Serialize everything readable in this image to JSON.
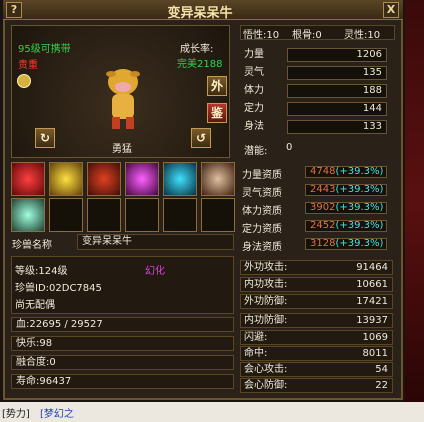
{
  "window": {
    "title": "变异呆呆牛",
    "help_label": "?",
    "close_label": "X"
  },
  "pet": {
    "level_carry": "95级可携带",
    "rarity": "贵重",
    "growth_label": "成长率:",
    "growth_value": "完美2188",
    "external_btn": "外",
    "inspect_btn": "鉴",
    "temperament": "勇猛",
    "name_label": "珍兽名称",
    "name_value": "变异呆呆牛",
    "level": "等级:124级",
    "transform": "幻化",
    "pet_id": "珍兽ID:02DC7845",
    "spouse": "尚无配偶",
    "hp": "血:22695 / 29527",
    "happiness": "快乐:98",
    "fusion": "融合度:0",
    "lifespan": "寿命:96437"
  },
  "header_stats": {
    "wuxing": "悟性:10",
    "genbone": "根骨:0",
    "lingxing": "灵性:10"
  },
  "stats": [
    {
      "name": "力量",
      "value": "1206"
    },
    {
      "name": "灵气",
      "value": "135"
    },
    {
      "name": "体力",
      "value": "188"
    },
    {
      "name": "定力",
      "value": "144"
    },
    {
      "name": "身法",
      "value": "133"
    }
  ],
  "potential": {
    "label": "潜能:",
    "value": "0"
  },
  "aptitudes": [
    {
      "name": "力量资质",
      "base": "4748",
      "bonus": "(+39.3%)"
    },
    {
      "name": "灵气资质",
      "base": "2443",
      "bonus": "(+39.3%)"
    },
    {
      "name": "体力资质",
      "base": "3902",
      "bonus": "(+39.3%)"
    },
    {
      "name": "定力资质",
      "base": "2452",
      "bonus": "(+39.3%)"
    },
    {
      "name": "身法资质",
      "base": "3128",
      "bonus": "(+39.3%)"
    }
  ],
  "combat": [
    {
      "name": "外功攻击:",
      "value": "91464"
    },
    {
      "name": "内功攻击:",
      "value": "10661"
    },
    {
      "name": "外功防御:",
      "value": "17421"
    },
    {
      "name": "内功防御:",
      "value": "13937"
    },
    {
      "name": "闪避:",
      "value": "1069"
    },
    {
      "name": "命中:",
      "value": "8011"
    },
    {
      "name": "会心攻击:",
      "value": "54"
    },
    {
      "name": "会心防御:",
      "value": "22"
    }
  ],
  "chat": {
    "text": "[势力]",
    "link": "[梦幻之"
  },
  "colors": {
    "gold": "#f2d24a",
    "green": "#34d24a",
    "red": "#ff3a2a",
    "orange": "#e8703a",
    "cyan": "#4ae0e0",
    "magenta": "#e040e0"
  }
}
